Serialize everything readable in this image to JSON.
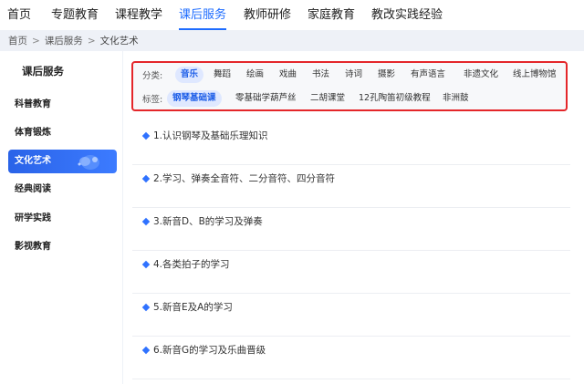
{
  "topnav": {
    "items": [
      {
        "label": "首页"
      },
      {
        "label": "专题教育"
      },
      {
        "label": "课程教学"
      },
      {
        "label": "课后服务"
      },
      {
        "label": "教师研修"
      },
      {
        "label": "家庭教育"
      },
      {
        "label": "教改实践经验"
      }
    ],
    "active_index": 3
  },
  "breadcrumb": {
    "items": [
      "首页",
      "课后服务",
      "文化艺术"
    ],
    "separator": ">"
  },
  "sidebar": {
    "title": "课后服务",
    "items": [
      {
        "label": "科普教育"
      },
      {
        "label": "体育锻炼"
      },
      {
        "label": "文化艺术"
      },
      {
        "label": "经典阅读"
      },
      {
        "label": "研学实践"
      },
      {
        "label": "影视教育"
      }
    ],
    "active_index": 2
  },
  "filters": {
    "category_label": "分类:",
    "categories": [
      "音乐",
      "舞蹈",
      "绘画",
      "戏曲",
      "书法",
      "诗词",
      "摄影",
      "有声语言",
      "非遗文化",
      "线上博物馆"
    ],
    "active_category": 0,
    "tag_label": "标签:",
    "tags": [
      "钢琴基础课",
      "零基础学葫芦丝",
      "二胡课堂",
      "12孔陶笛初级教程",
      "非洲鼓"
    ],
    "active_tag": 0
  },
  "lessons": [
    {
      "title": "1.认识钢琴及基础乐理知识"
    },
    {
      "title": "2.学习、弹奏全音符、二分音符、四分音符"
    },
    {
      "title": "3.新音D、B的学习及弹奏"
    },
    {
      "title": "4.各类拍子的学习"
    },
    {
      "title": "5.新音E及A的学习"
    },
    {
      "title": "6.新音G的学习及乐曲晋级"
    }
  ],
  "colors": {
    "accent": "#1e6cff",
    "sidebar_active": "#2a63e8",
    "highlight_border": "#e4262a"
  }
}
